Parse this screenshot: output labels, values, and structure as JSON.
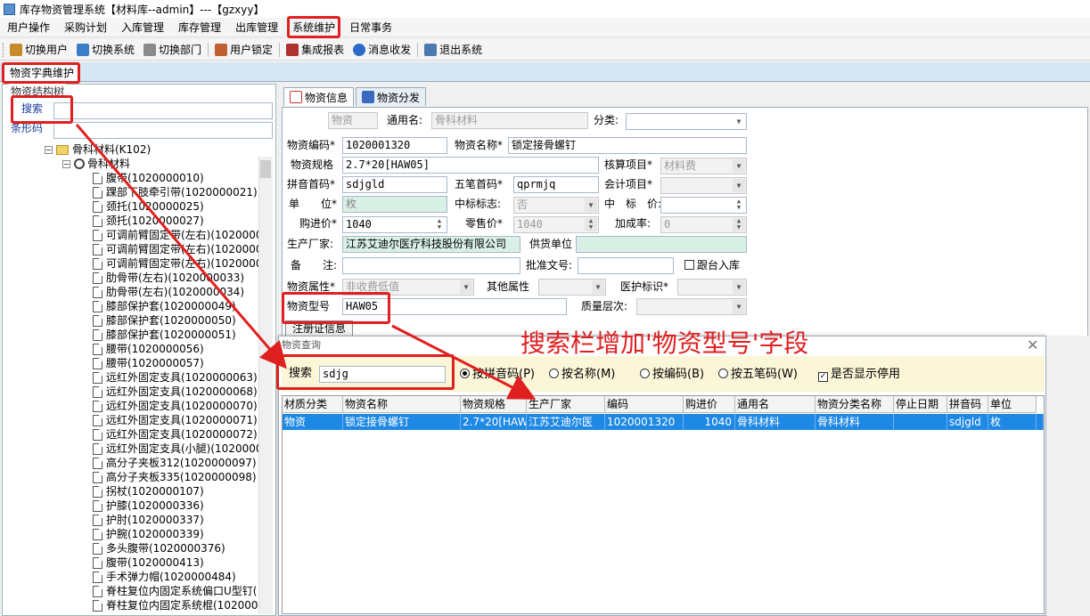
{
  "window": {
    "title": "库存物资管理系统【材料库--admin】---【gzxyy】"
  },
  "menu": [
    "用户操作",
    "采购计划",
    "入库管理",
    "库存管理",
    "出库管理",
    "系统维护",
    "日常事务"
  ],
  "toolbar": [
    {
      "label": "切换用户",
      "icon": "switch-user-icon",
      "color": "#c98a2a"
    },
    {
      "label": "切换系统",
      "icon": "switch-system-icon",
      "color": "#3a7dc8"
    },
    {
      "label": "切换部门",
      "icon": "switch-dept-icon",
      "color": "#7a7a7a"
    },
    {
      "label": "用户锁定",
      "icon": "user-lock-icon",
      "color": "#c06030"
    },
    {
      "label": "集成报表",
      "icon": "report-icon",
      "color": "#b03030"
    },
    {
      "label": "消息收发",
      "icon": "message-icon",
      "color": "#2a6ac8"
    },
    {
      "label": "退出系统",
      "icon": "exit-icon",
      "color": "#4a7ab0"
    }
  ],
  "main_tab": "物资字典维护",
  "left": {
    "group_title": "物资结构树",
    "search_label": "搜索",
    "barcode_label": "条形码",
    "tree": {
      "root": "骨科材料(K102)",
      "child": "骨科材料",
      "items": [
        "腹带(1020000010)",
        "踝部下肢牵引带(1020000021)",
        "颈托(1020000025)",
        "颈托(1020000027)",
        "可调前臂固定带(左右)(10200000",
        "可调前臂固定带(左右)(10200000",
        "可调前臂固定带(左右)(10200000",
        "肋骨带(左右)(1020000033)",
        "肋骨带(左右)(1020000034)",
        "膝部保护套(1020000049)",
        "膝部保护套(1020000050)",
        "膝部保护套(1020000051)",
        "腰带(1020000056)",
        "腰带(1020000057)",
        "远红外固定支具(1020000063)",
        "远红外固定支具(1020000068)",
        "远红外固定支具(1020000070)",
        "远红外固定支具(1020000071)",
        "远红外固定支具(1020000072)",
        "远红外固定支具(小腿)(1020000",
        "高分子夹板312(1020000097)",
        "高分子夹板335(1020000098)",
        "拐杖(1020000107)",
        "护膝(1020000336)",
        "护肘(1020000337)",
        "护腕(1020000339)",
        "多头腹带(1020000376)",
        "腹带(1020000413)",
        "手术弹力帽(1020000484)",
        "脊柱复位内固定系统偏口U型钉(",
        "脊柱复位内固定系统棍(1020001"
      ]
    }
  },
  "right_tabs": [
    "物资信息",
    "物资分发"
  ],
  "form": {
    "category_value": "物资",
    "common_name_label": "通用名:",
    "common_name_value": "骨科材料",
    "class_label": "分类:",
    "code_label": "物资编码*",
    "code_value": "1020001320",
    "name_label": "物资名称*",
    "name_value": "锁定接骨螺钉",
    "spec_label": "物资规格",
    "spec_value": "2.7*20[HAW05]",
    "account_label": "核算项目*",
    "account_value": "材料费",
    "pinyin_label": "拼音首码*",
    "pinyin_value": "sdjgld",
    "wubi_label": "五笔首码*",
    "wubi_value": "qprmjq",
    "accounting_label": "会计项目*",
    "unit_label": "单　　位*",
    "unit_value": "枚",
    "bid_flag_label": "中标标志:",
    "bid_flag_value": "否",
    "bid_price_label": "中　标　价:",
    "purchase_label": "购进价*",
    "purchase_value": "1040",
    "retail_label": "零售价*",
    "retail_value": "1040",
    "markup_label": "加成率:",
    "markup_value": "0",
    "manufacturer_label": "生产厂家:",
    "manufacturer_value": "江苏艾迪尔医疗科技股份有限公司",
    "supplier_label": "供货单位",
    "remark_label": "备　　注:",
    "approval_label": "批准文号:",
    "follow_label": "跟台入库",
    "attr_label": "物资属性*",
    "attr_value": "非收费低值",
    "other_attr_label": "其他属性",
    "insurance_label": "医护标识*",
    "model_label": "物资型号",
    "model_value": "HAW05",
    "quality_label": "质量层次:",
    "reg_cert_label": "注册证信息"
  },
  "annotation": "搜索栏增加'物资型号'字段",
  "dialog": {
    "title": "物资查询",
    "search_label": "搜索",
    "search_value": "sdjg",
    "options": [
      {
        "label": "按拼音码(P)",
        "checked": true
      },
      {
        "label": "按名称(M)",
        "checked": false
      },
      {
        "label": "按编码(B)",
        "checked": false
      },
      {
        "label": "按五笔码(W)",
        "checked": false
      }
    ],
    "show_disabled_label": "是否显示停用",
    "columns": [
      "材质分类",
      "物资名称",
      "物资规格",
      "生产厂家",
      "编码",
      "购进价",
      "通用名",
      "物资分类名称",
      "停止日期",
      "拼音码",
      "单位"
    ],
    "rows": [
      [
        "物资",
        "锁定接骨螺钉",
        "2.7*20[HAW",
        "江苏艾迪尔医",
        "1020001320",
        "1040",
        "骨科材料",
        "骨科材料",
        "",
        "sdjgld",
        "枚"
      ]
    ]
  },
  "colors": {
    "accent": "#e02020",
    "selection": "#1e88e5"
  }
}
